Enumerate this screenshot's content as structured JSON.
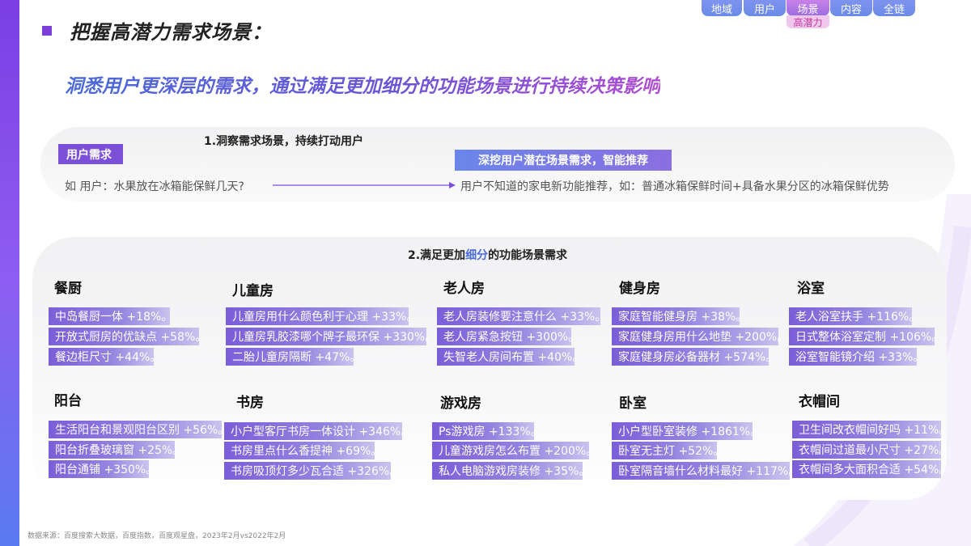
{
  "nav": {
    "tabs": [
      "地域",
      "用户",
      "场景",
      "内容",
      "全链"
    ],
    "active_sub": "高潜力"
  },
  "title": "把握高潜力需求场景：",
  "subtitle": "洞悉用户更深层的需求，通过满足更加细分的功能场景进行持续决策影响",
  "section1": {
    "heading": "1.洞察需求场景，持续打动用户",
    "tag_left": "用户需求",
    "tag_right": "深挖用户潜在场景需求，智能推荐",
    "example_left": "如 用户：水果放在冰箱能保鲜几天?",
    "example_right": "用户不知道的家电新功能推荐，如：普通冰箱保鲜时间+具备水果分区的冰箱保鲜优势"
  },
  "section2": {
    "heading_pre": "2.满足更加",
    "heading_hl": "细分",
    "heading_post": "的功能场景需求",
    "scenes": [
      {
        "title": "餐厨",
        "items": [
          "中岛餐厨一体 +18%。",
          "开放式厨房的优缺点 +58%。",
          "餐边柜尺寸 +44%。"
        ]
      },
      {
        "title": "儿童房",
        "items": [
          "儿童房用什么颜色利于心理 +33%。",
          "儿童房乳胶漆哪个牌子最环保 +330%。",
          "二胎儿童房隔断 +47%。"
        ]
      },
      {
        "title": "老人房",
        "items": [
          "老人房装修要注意什么 +33%。",
          "老人房紧急按钮 +300%。",
          "失智老人房间布置 +40%。"
        ]
      },
      {
        "title": "健身房",
        "items": [
          "家庭智能健身房 +38%。",
          "家庭健身房用什么地垫 +200%。",
          "家庭健身房必备器材 +574%。"
        ]
      },
      {
        "title": "浴室",
        "items": [
          "老人浴室扶手 +116%。",
          "日式整体浴室定制 +106%。",
          "浴室智能镜介绍 +33%。"
        ]
      },
      {
        "title": "阳台",
        "items": [
          "生活阳台和景观阳台区别 +56%。",
          "阳台折叠玻璃窗 +25%。",
          "阳台通铺 +350%。"
        ]
      },
      {
        "title": "书房",
        "items": [
          "小户型客厅书房一体设计 +346%。",
          "书房里点什么香提神 +69%。",
          "书房吸顶灯多少瓦合适 +326%。"
        ]
      },
      {
        "title": "游戏房",
        "items": [
          "Ps游戏房 +133%。",
          "儿童游戏房怎么布置 +200%。",
          "私人电脑游戏房装修 +35%。"
        ]
      },
      {
        "title": "卧室",
        "items": [
          "小户型卧室装修 +1861%。",
          "卧室无主灯 +52%。",
          "卧室隔音墙什么材料最好 +117%。"
        ]
      },
      {
        "title": "衣帽间",
        "items": [
          "卫生间改衣帽间好吗 +11%。",
          "衣帽间过道最小尺寸 +27%。",
          "衣帽间多大面积合适 +54%。"
        ]
      }
    ]
  },
  "footnote": "数据来源：百度搜索大数据，百度指数，百度观星盘，2023年2月vs2022年2月",
  "colors": {
    "accent": "#7c4fd9",
    "blue": "#4a6bd8",
    "sidebar": "#7b3fe4"
  }
}
